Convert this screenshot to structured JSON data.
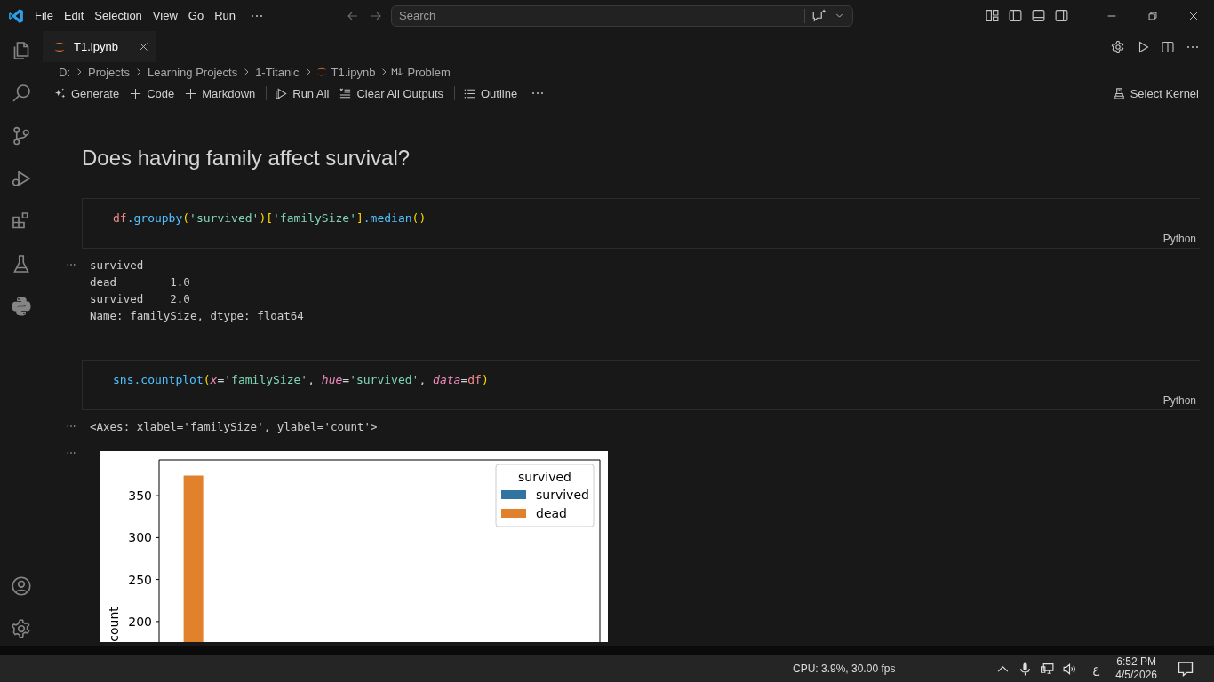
{
  "menu_bar": {
    "items": [
      "File",
      "Edit",
      "Selection",
      "View",
      "Go",
      "Run"
    ]
  },
  "search": {
    "placeholder": "Search"
  },
  "tabs": [
    {
      "label": "T1.ipynb",
      "selected": true
    }
  ],
  "breadcrumbs": [
    {
      "label": "D:",
      "kind": "plain"
    },
    {
      "label": "Projects",
      "kind": "plain"
    },
    {
      "label": "Learning Projects",
      "kind": "plain"
    },
    {
      "label": "1-Titanic",
      "kind": "plain"
    },
    {
      "label": "T1.ipynb",
      "kind": "notebook"
    },
    {
      "label": "Problem",
      "kind": "markdown"
    }
  ],
  "toolbar": {
    "items": [
      {
        "label": "Generate",
        "kind": "sparkle"
      },
      {
        "label": "Code",
        "kind": "add"
      },
      {
        "label": "Markdown",
        "kind": "add"
      },
      {
        "label": "Run All",
        "kind": "run",
        "divider": true
      },
      {
        "label": "Clear All Outputs",
        "kind": "clear"
      },
      {
        "label": "Outline",
        "kind": "outline",
        "divider": true
      }
    ],
    "kernel": "Select Kernel"
  },
  "cells": [
    {
      "kind": "markdown",
      "text": "Does having family affect survival?"
    },
    {
      "kind": "code",
      "language": "Python",
      "tokens": [
        {
          "t": "df",
          "kind": "var"
        },
        {
          "t": ".groupby",
          "kind": "fn"
        },
        {
          "t": "(",
          "kind": "bracket"
        },
        {
          "t": "'survived'",
          "kind": "str"
        },
        {
          "t": ")[",
          "kind": "bracket"
        },
        {
          "t": "'familySize'",
          "kind": "str"
        },
        {
          "t": "]",
          "kind": "bracket"
        },
        {
          "t": ".median",
          "kind": "fn"
        },
        {
          "t": "()",
          "kind": "bracket"
        }
      ],
      "outputs": [
        {
          "kind": "text",
          "lines": [
            "survived",
            "dead        1.0",
            "survived    2.0",
            "Name: familySize, dtype: float64"
          ]
        }
      ]
    },
    {
      "kind": "code",
      "language": "Python",
      "tokens": [
        {
          "t": "sns",
          "kind": "fn"
        },
        {
          "t": ".countplot",
          "kind": "fn"
        },
        {
          "t": "(",
          "kind": "bracket"
        },
        {
          "t": "x",
          "kind": "param"
        },
        {
          "t": "=",
          "kind": "punc"
        },
        {
          "t": "'familySize'",
          "kind": "str"
        },
        {
          "t": ", ",
          "kind": "punc"
        },
        {
          "t": "hue",
          "kind": "param"
        },
        {
          "t": "=",
          "kind": "punc"
        },
        {
          "t": "'survived'",
          "kind": "str"
        },
        {
          "t": ", ",
          "kind": "punc"
        },
        {
          "t": "data",
          "kind": "param"
        },
        {
          "t": "=",
          "kind": "punc"
        },
        {
          "t": "df",
          "kind": "var"
        },
        {
          "t": ")",
          "kind": "bracket"
        }
      ],
      "outputs": [
        {
          "kind": "text",
          "lines": [
            "<Axes: xlabel='familySize', ylabel='count'>"
          ]
        },
        {
          "kind": "chart",
          "chart_data": {
            "type": "bar",
            "ylabel": "count",
            "legend_title": "survived",
            "ylim": [
              175.5,
              392.5
            ],
            "yticks": [
              200,
              250,
              300,
              350
            ],
            "series": [
              {
                "name": "survived",
                "color": "#3274a1",
                "values": [
                  null
                ]
              },
              {
                "name": "dead",
                "color": "#e1812c",
                "values": [
                  374
                ]
              }
            ]
          }
        }
      ]
    }
  ],
  "taskbar": {
    "status": "CPU: 3.9%, 30.00 fps",
    "language": "ع",
    "time": "6:52 PM",
    "date": "4/5/2026"
  }
}
